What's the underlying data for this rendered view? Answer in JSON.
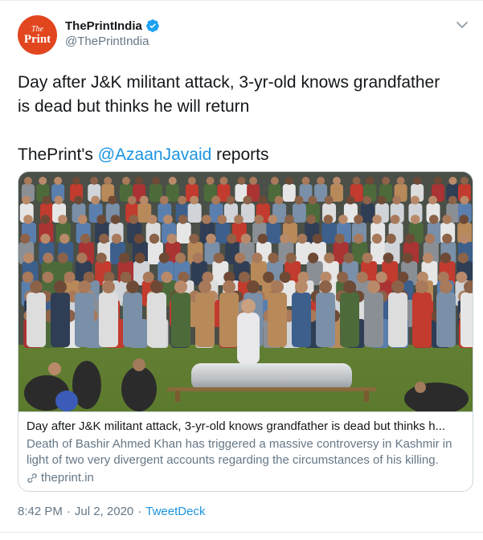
{
  "author": {
    "display_name": "ThePrintIndia",
    "handle": "@ThePrintIndia",
    "avatar_logo": {
      "line1": "The",
      "line2": "Print"
    },
    "verified_icon": "verified-badge-icon",
    "brand_color": "#e2461f"
  },
  "tweet": {
    "line1": "Day after J&K militant attack, 3-yr-old knows grandfather",
    "line2": "is dead but thinks he will return",
    "prefix": "ThePrint's ",
    "mention": "@AzaanJavaid",
    "suffix": " reports"
  },
  "card": {
    "title": "Day after J&K militant attack, 3-yr-old knows grandfather is dead but thinks h...",
    "description": "Death of Bashir Ahmed Khan has triggered a massive controversy in Kashmir in light of two very divergent accounts regarding the circumstances of his killing.",
    "domain": "theprint.in",
    "domain_icon": "link-icon"
  },
  "meta": {
    "time": "8:42 PM",
    "separator1": "·",
    "date": "Jul 2, 2020",
    "separator2": "·",
    "source": "TweetDeck"
  },
  "colors": {
    "link": "#1b95e0",
    "secondary_text": "#657786",
    "border": "#ccd6dd"
  }
}
